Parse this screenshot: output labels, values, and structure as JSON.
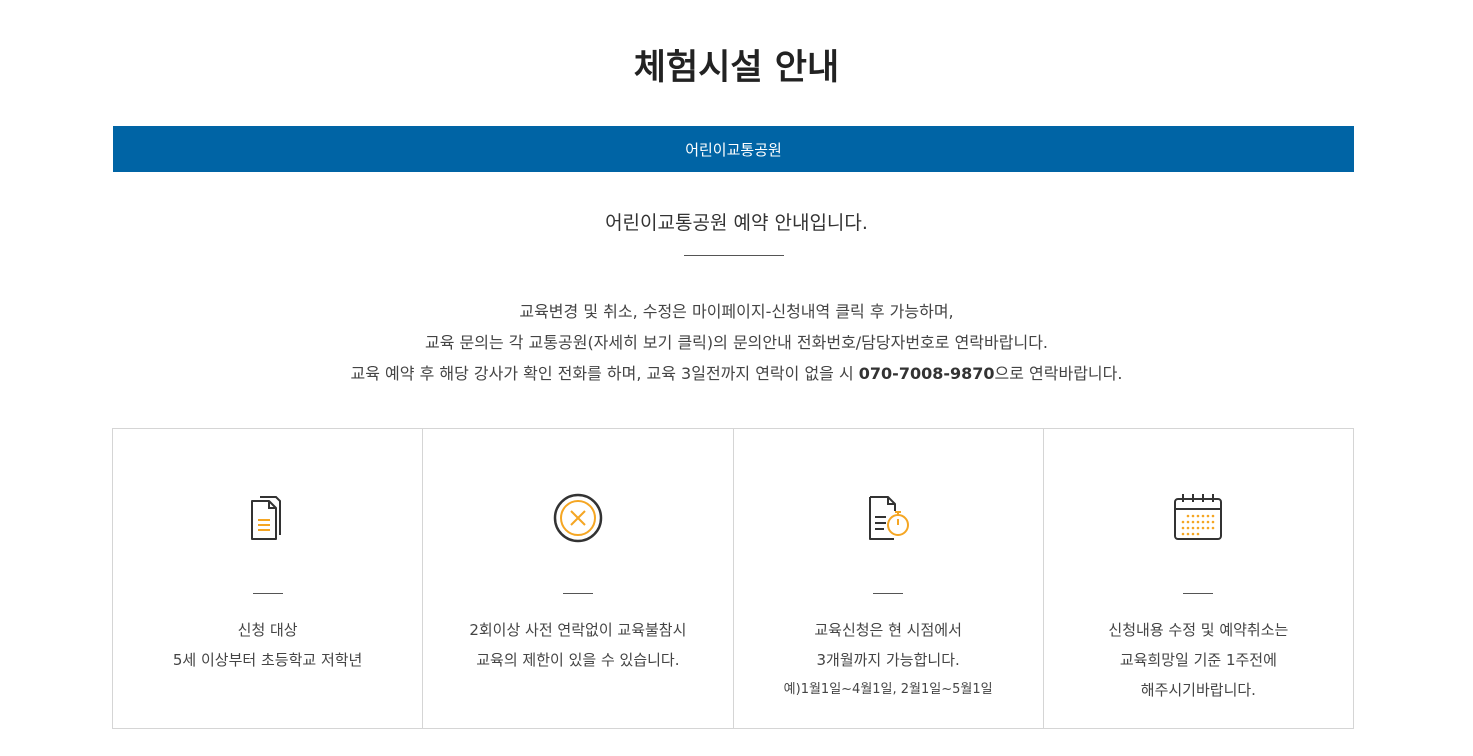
{
  "page": {
    "title": "체험시설 안내"
  },
  "tabs": [
    {
      "label": "어린이교통공원",
      "active": true
    }
  ],
  "intro": {
    "subtitle": "어린이교통공원 예약 안내입니다.",
    "notice_line1": "교육변경 및 취소, 수정은 마이페이지-신청내역 클릭 후 가능하며,",
    "notice_line2": "교육 문의는 각 교통공원(자세히 보기 클릭)의 문의안내 전화번호/담당자번호로 연락바랍니다.",
    "notice_line3_prefix": "교육 예약 후 해당 강사가 확인 전화를 하며, 교육 3일전까지 연락이 없을 시 ",
    "notice_phone": "070-7008-9870",
    "notice_line3_suffix": "으로 연락바랍니다."
  },
  "cards": [
    {
      "icon": "document-icon",
      "line1": "신청 대상",
      "line2": "5세 이상부터 초등학교 저학년",
      "line3": ""
    },
    {
      "icon": "cancel-circle-icon",
      "line1": "2회이상 사전 연락없이 교육불참시",
      "line2": "교육의 제한이 있을 수 있습니다.",
      "line3": ""
    },
    {
      "icon": "document-timer-icon",
      "line1": "교육신청은 현 시점에서",
      "line2": "3개월까지 가능합니다.",
      "line3": "예)1월1일~4월1일, 2월1일~5월1일"
    },
    {
      "icon": "calendar-icon",
      "line1": "신청내용 수정 및 예약취소는",
      "line2": "교육희망일 기준 1주전에",
      "line3": "해주시기바랍니다."
    }
  ],
  "colors": {
    "accent": "#0064a5",
    "icon_highlight": "#f5a623",
    "icon_stroke": "#333333"
  }
}
